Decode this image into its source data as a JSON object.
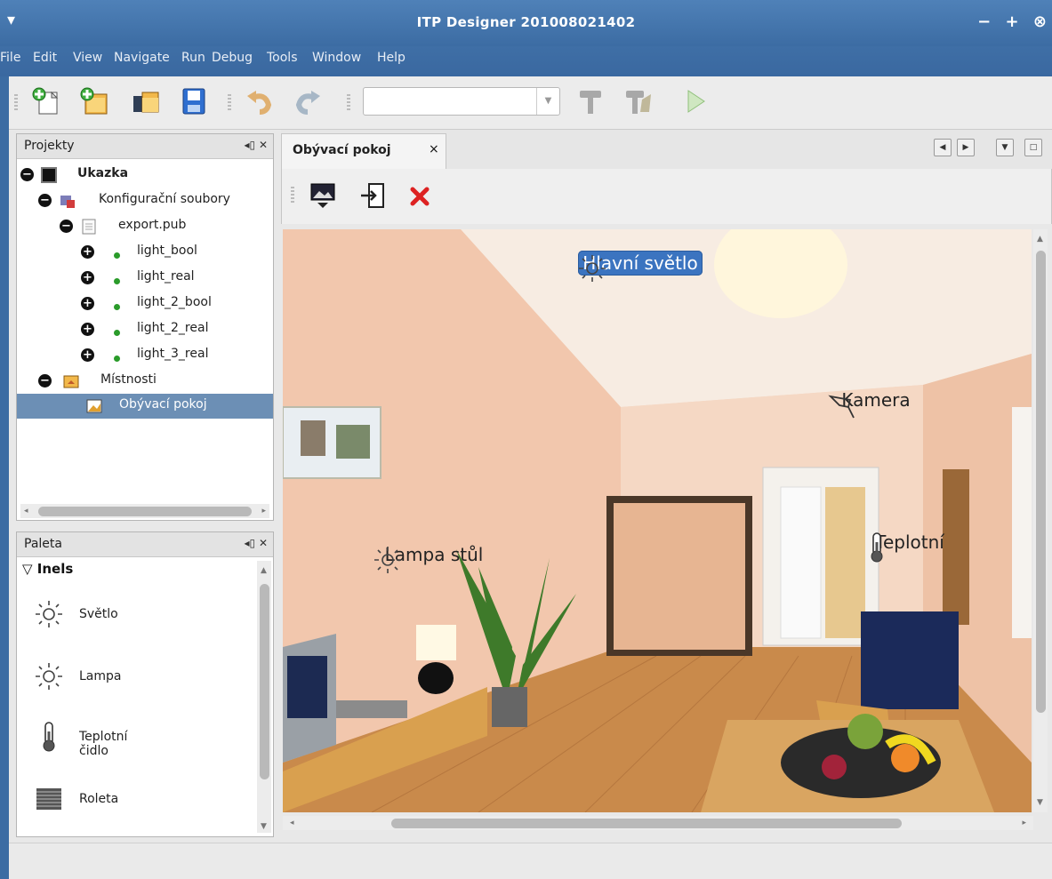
{
  "window": {
    "title": "ITP Designer 201008021402",
    "controls": [
      "−",
      "+",
      "⊗"
    ]
  },
  "menu": {
    "items": [
      "File",
      "Edit",
      "View",
      "Navigate",
      "Run",
      "Debug",
      "Tools",
      "Window",
      "Help"
    ]
  },
  "toolbar": {
    "icons": [
      "new-project-icon",
      "new-file-icon",
      "open-project-icon",
      "save-all-icon",
      "undo-icon",
      "redo-icon",
      "build-icon",
      "clean-build-icon",
      "run-icon"
    ],
    "config_combo": {
      "value": ""
    }
  },
  "projects_panel": {
    "title": "Projekty",
    "controls": "◂▯ ✕",
    "tree": [
      {
        "label": "Ukazka",
        "level": 0,
        "expander": "−",
        "bold": true,
        "icon": "project-icon"
      },
      {
        "label": "Konfigurační soubory",
        "level": 1,
        "expander": "−",
        "icon": "config-files-icon"
      },
      {
        "label": "export.pub",
        "level": 2,
        "expander": "−",
        "icon": "file-icon"
      },
      {
        "label": "light_bool",
        "level": 3,
        "expander": "+",
        "icon": "green-dot-icon"
      },
      {
        "label": "light_real",
        "level": 3,
        "expander": "+",
        "icon": "green-dot-icon"
      },
      {
        "label": "light_2_bool",
        "level": 3,
        "expander": "+",
        "icon": "green-dot-icon"
      },
      {
        "label": "light_2_real",
        "level": 3,
        "expander": "+",
        "icon": "green-dot-icon"
      },
      {
        "label": "light_3_real",
        "level": 3,
        "expander": "+",
        "icon": "green-dot-icon"
      },
      {
        "label": "Místnosti",
        "level": 1,
        "expander": "−",
        "icon": "rooms-folder-icon"
      },
      {
        "label": "Obývací pokoj",
        "level": 2,
        "expander": "",
        "icon": "room-image-icon",
        "selected": true
      }
    ]
  },
  "palette_panel": {
    "title": "Paleta",
    "controls": "◂▯ ✕",
    "category": "Inels",
    "items": [
      {
        "label": "Světlo",
        "icon": "sun-icon"
      },
      {
        "label": "Lampa",
        "icon": "sun-icon"
      },
      {
        "label": "Teplotní čidlo",
        "icon": "thermometer-icon"
      },
      {
        "label": "Roleta",
        "icon": "blind-icon"
      }
    ]
  },
  "editor": {
    "tab_label": "Obývací pokoj",
    "tab_close": "×",
    "toolbar_icons": [
      "set-background-icon",
      "import-icon",
      "delete-icon"
    ],
    "markers": [
      {
        "label": "Hlavní světlo",
        "icon": "sun-icon",
        "selected": true
      },
      {
        "label": "Kamera",
        "icon": "camera-icon",
        "selected": false
      },
      {
        "label": "Lampa stůl",
        "icon": "sun-icon",
        "selected": false
      },
      {
        "label": "Teplotní",
        "icon": "thermometer-icon",
        "selected": false
      }
    ]
  },
  "colors": {
    "titlebar": "#4577ae",
    "selection": "#3b74c0",
    "wall": "#f3d6c2",
    "floor": "#c98a4b"
  }
}
